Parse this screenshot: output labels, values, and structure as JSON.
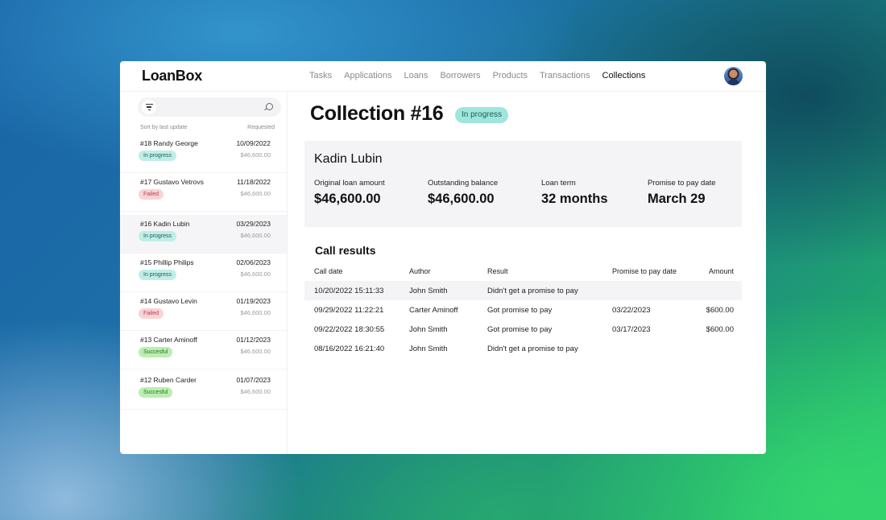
{
  "app": {
    "logo": "LoanBox"
  },
  "nav": {
    "items": [
      "Tasks",
      "Applications",
      "Loans",
      "Borrowers",
      "Products",
      "Transactions",
      "Collections"
    ],
    "active": "Collections"
  },
  "sidebar": {
    "search_placeholder": "",
    "sort_label": "Sort by last update",
    "requested_label": "Requested",
    "items": [
      {
        "title": "#18 Randy George",
        "date": "10/09/2022",
        "amount": "$46,600.00",
        "status": "In progress"
      },
      {
        "title": "#17 Gustavo Vetrovs",
        "date": "11/18/2022",
        "amount": "$46,600.00",
        "status": "Failed"
      },
      {
        "title": "#16 Kadin Lubin",
        "date": "03/29/2023",
        "amount": "$46,600.00",
        "status": "In progress"
      },
      {
        "title": "#15 Phillip Philips",
        "date": "02/06/2023",
        "amount": "$46,600.00",
        "status": "In progress"
      },
      {
        "title": "#14 Gustavo Levin",
        "date": "01/19/2023",
        "amount": "$46,600.00",
        "status": "Failed"
      },
      {
        "title": "#13 Carter Aminoff",
        "date": "01/12/2023",
        "amount": "$46,600.00",
        "status": "Succesful"
      },
      {
        "title": "#12 Ruben Carder",
        "date": "01/07/2023",
        "amount": "$46,600.00",
        "status": "Succesful"
      }
    ]
  },
  "main": {
    "title": "Collection #16",
    "status": "In progress",
    "borrower": "Kadin Lubin",
    "stats": [
      {
        "label": "Original loan amount",
        "value": "$46,600.00"
      },
      {
        "label": "Outstanding balance",
        "value": "$46,600.00"
      },
      {
        "label": "Loan term",
        "value": "32 months"
      },
      {
        "label": "Promise to pay date",
        "value": "March 29"
      }
    ],
    "calls_title": "Call results",
    "calls_headers": [
      "Call date",
      "Author",
      "Result",
      "Promise to pay date",
      "Amount"
    ],
    "calls": [
      [
        "10/20/2022 15:11:33",
        "John Smith",
        "Didn't get a promise to pay",
        "",
        ""
      ],
      [
        "09/29/2022 11:22:21",
        "Carter Aminoff",
        "Got promise to pay",
        "03/22/2023",
        "$600.00"
      ],
      [
        "09/22/2022 18:30:55",
        "John Smith",
        "Got promise to pay",
        "03/17/2023",
        "$600.00"
      ],
      [
        "08/16/2022 16:21:40",
        "John Smith",
        "Didn't get a promise to pay",
        "",
        ""
      ]
    ]
  }
}
